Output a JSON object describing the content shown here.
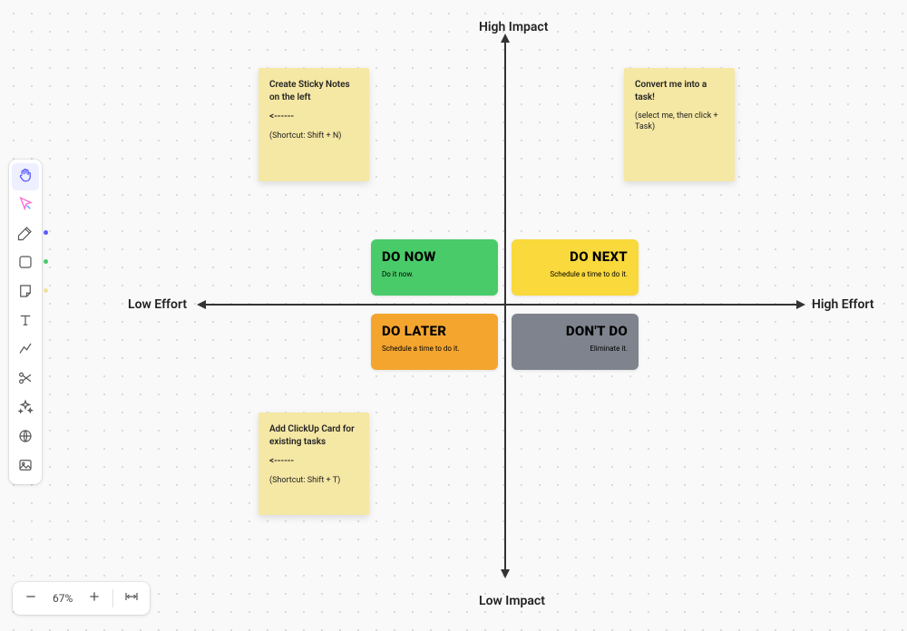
{
  "axes": {
    "top": "High Impact",
    "bottom": "Low Impact",
    "left": "Low Effort",
    "right": "High Effort"
  },
  "quadrants": {
    "do_now": {
      "title": "DO NOW",
      "subtitle": "Do it now."
    },
    "do_next": {
      "title": "DO NEXT",
      "subtitle": "Schedule a time to do it."
    },
    "do_later": {
      "title": "DO LATER",
      "subtitle": "Schedule a time to do it."
    },
    "dont_do": {
      "title": "DON'T DO",
      "subtitle": "Eliminate it."
    }
  },
  "stickies": {
    "top_left": {
      "main": "Create Sticky Notes on the left",
      "arrow": "<------",
      "sub": "(Shortcut: Shift + N)"
    },
    "top_right": {
      "main": "Convert me into a task!",
      "sub": "(select me, then click + Task)"
    },
    "bottom_left": {
      "main": "Add ClickUp Card for existing tasks",
      "arrow": "<------",
      "sub": "(Shortcut: Shift + T)"
    }
  },
  "toolbar": {
    "tools": [
      {
        "name": "hand-tool",
        "icon": "hand",
        "active": true
      },
      {
        "name": "select-tool",
        "icon": "select",
        "multicolor": true
      },
      {
        "name": "pen-tool",
        "icon": "pen",
        "dot": "#5b5bff"
      },
      {
        "name": "shape-tool",
        "icon": "square",
        "dot": "#4acb6a"
      },
      {
        "name": "sticky-tool",
        "icon": "note",
        "dot": "#f5e7a4"
      },
      {
        "name": "text-tool",
        "icon": "text"
      },
      {
        "name": "connector-tool",
        "icon": "connector"
      },
      {
        "name": "scissors-tool",
        "icon": "scissors"
      },
      {
        "name": "ai-tool",
        "icon": "sparkle"
      },
      {
        "name": "web-tool",
        "icon": "globe"
      },
      {
        "name": "image-tool",
        "icon": "image"
      }
    ]
  },
  "zoom": {
    "level": "67%"
  }
}
